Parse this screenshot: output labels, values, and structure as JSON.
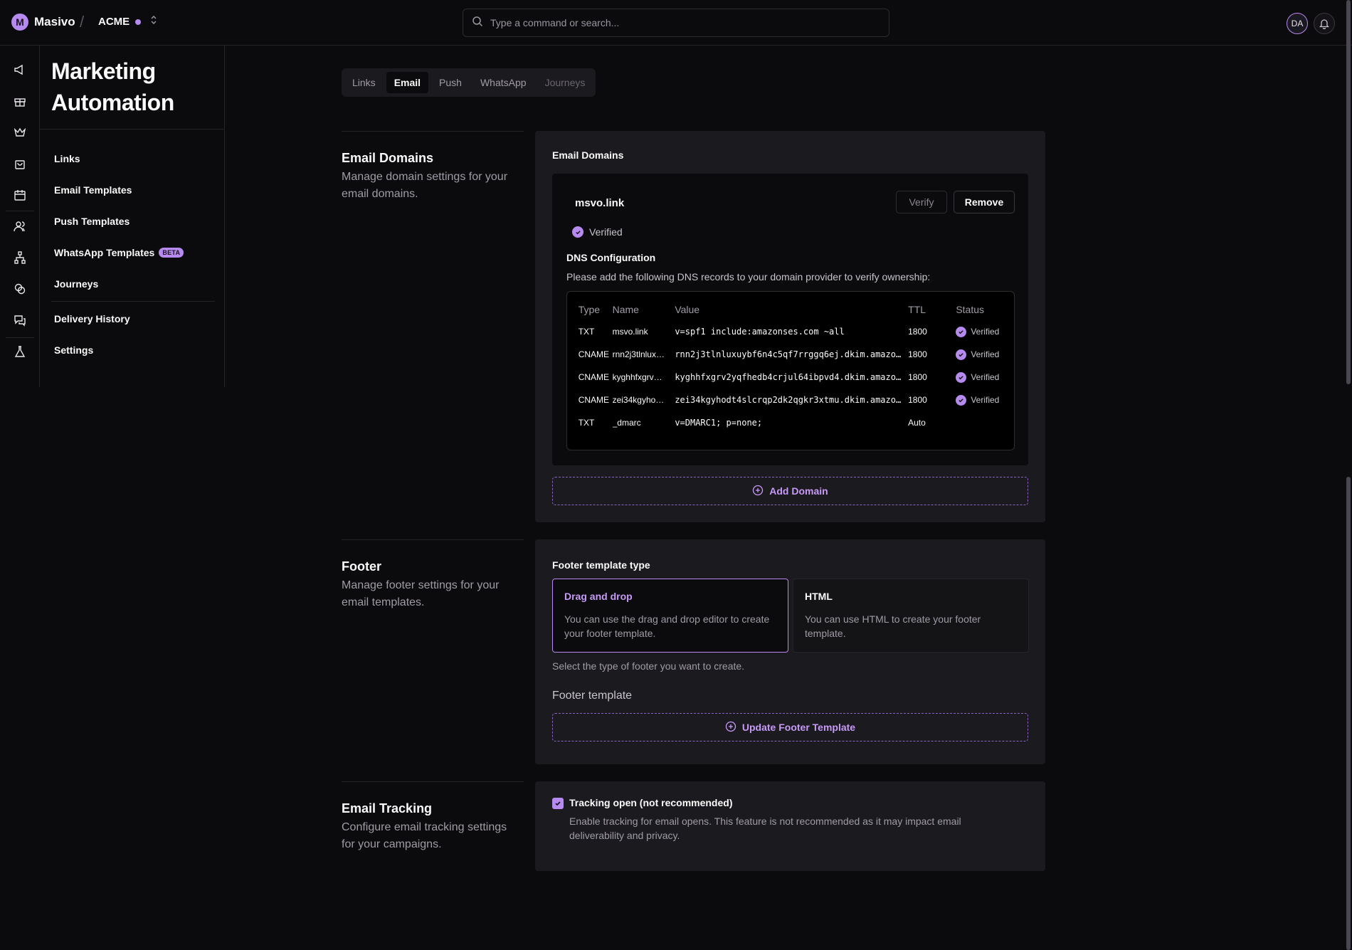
{
  "app": {
    "name": "Masivo",
    "org": "ACME"
  },
  "search": {
    "placeholder": "Type a command or search..."
  },
  "user": {
    "initials": "DA"
  },
  "rail_icons": [
    "megaphone-icon",
    "gift-icon",
    "crown-icon",
    "shopping-bag-icon",
    "calendar-icon",
    "users-icon",
    "hierarchy-icon",
    "coins-icon",
    "chat-icon",
    "flask-icon"
  ],
  "page": {
    "title": "Marketing Automation"
  },
  "sidebar": {
    "items": [
      {
        "label": "Links"
      },
      {
        "label": "Email Templates"
      },
      {
        "label": "Push Templates"
      },
      {
        "label": "WhatsApp Templates",
        "badge": "BETA"
      },
      {
        "label": "Journeys"
      },
      {
        "label": "Delivery History"
      },
      {
        "label": "Settings"
      }
    ]
  },
  "tabs": [
    {
      "label": "Links"
    },
    {
      "label": "Email",
      "active": true
    },
    {
      "label": "Push"
    },
    {
      "label": "WhatsApp"
    },
    {
      "label": "Journeys",
      "disabled": true
    }
  ],
  "email_domains": {
    "section_title": "Email Domains",
    "section_desc": "Manage domain settings for your email domains.",
    "panel_label": "Email Domains",
    "domain": "msvo.link",
    "verify_label": "Verify",
    "remove_label": "Remove",
    "status": "Verified",
    "dns_title": "DNS Configuration",
    "dns_desc": "Please add the following DNS records to your domain provider to verify ownership:",
    "columns": [
      "Type",
      "Name",
      "Value",
      "TTL",
      "Status"
    ],
    "records": [
      {
        "type": "TXT",
        "name": "msvo.link",
        "value": "v=spf1 include:amazonses.com ~all",
        "ttl": "1800",
        "status": "Verified"
      },
      {
        "type": "CNAME",
        "name": "rnn2j3tlnlux…",
        "value": "rnn2j3tlnluxuybf6n4c5qf7rrggq6ej.dkim.amazo…",
        "ttl": "1800",
        "status": "Verified"
      },
      {
        "type": "CNAME",
        "name": "kyghhfxgrv…",
        "value": "kyghhfxgrv2yqfhedb4crjul64ibpvd4.dkim.amazo…",
        "ttl": "1800",
        "status": "Verified"
      },
      {
        "type": "CNAME",
        "name": "zei34kgyho…",
        "value": "zei34kgyhodt4slcrqp2dk2qgkr3xtmu.dkim.amazo…",
        "ttl": "1800",
        "status": "Verified"
      },
      {
        "type": "TXT",
        "name": "_dmarc",
        "value": "v=DMARC1; p=none;",
        "ttl": "Auto",
        "status": ""
      }
    ],
    "add_label": "Add Domain"
  },
  "footer": {
    "section_title": "Footer",
    "section_desc": "Manage footer settings for your email templates.",
    "type_label": "Footer template type",
    "options": [
      {
        "title": "Drag and drop",
        "desc": "You can use the drag and drop editor to create your footer template.",
        "selected": true
      },
      {
        "title": "HTML",
        "desc": "You can use HTML to create your footer template.",
        "selected": false
      }
    ],
    "help": "Select the type of footer you want to create.",
    "template_label": "Footer template",
    "update_label": "Update Footer Template"
  },
  "tracking": {
    "section_title": "Email Tracking",
    "section_desc": "Configure email tracking settings for your campaigns.",
    "checkbox_label": "Tracking open (not recommended)",
    "checkbox_checked": true,
    "checkbox_desc": "Enable tracking for email opens. This feature is not recommended as it may impact email deliverability and privacy."
  },
  "colors": {
    "accent": "#b78af0",
    "background": "#0b0a0c",
    "panel": "#1b1a1e"
  }
}
